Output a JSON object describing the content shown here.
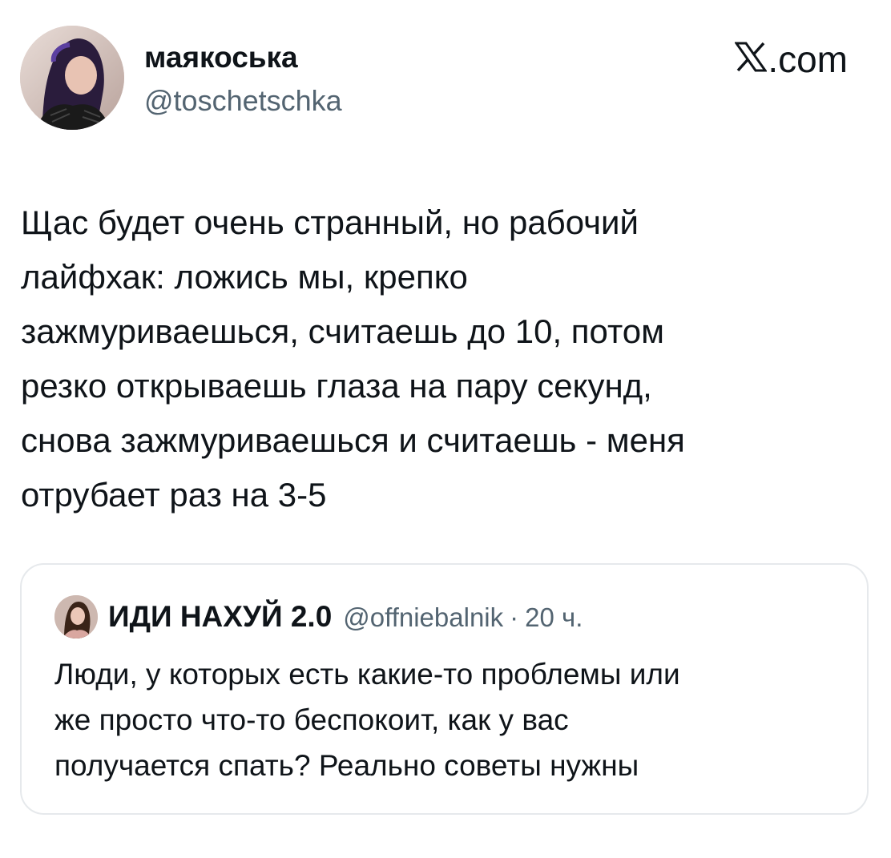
{
  "author": {
    "name": "маякоська",
    "handle": "@toschetschka"
  },
  "site": {
    "logo_icon": "x-logo-icon",
    "suffix": ".com"
  },
  "tweet": {
    "text": "Щас будет очень странный, но рабочий\nлайфхак: ложись мы, крепко\nзажмуриваешься, считаешь до 10, потом\nрезко открываешь глаза на пару секунд,\nснова зажмуриваешься и считаешь - меня\nотрубает раз на 3-5"
  },
  "quoted": {
    "name": "ИДИ НАХУЙ 2.0",
    "handle": "@offniebalnik",
    "separator": "·",
    "time": "20 ч.",
    "text": "Люди, у которых есть какие-то проблемы или\nже просто что-то беспокоит, как у вас\nполучается спать? Реально советы нужны"
  },
  "colors": {
    "text": "#0f1419",
    "secondary": "#536471",
    "border": "#e6e9ec",
    "background": "#ffffff"
  }
}
